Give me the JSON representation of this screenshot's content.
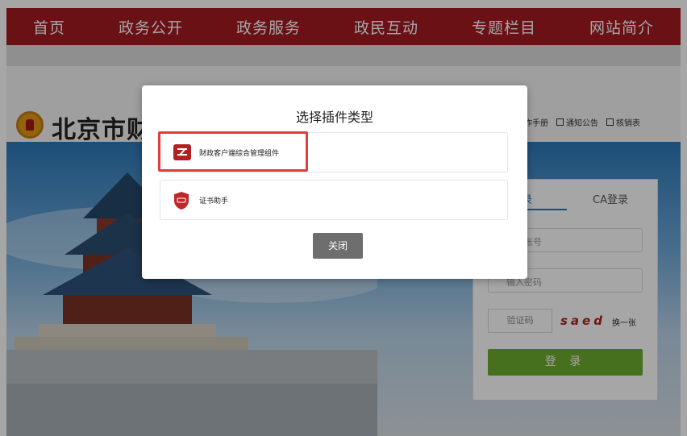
{
  "nav": {
    "items": [
      "首页",
      "政务公开",
      "政务服务",
      "政民互动",
      "专题栏目",
      "网站简介"
    ]
  },
  "header": {
    "site_title": "北京市财政",
    "links": [
      "操作手册",
      "通知公告",
      "核销表"
    ]
  },
  "login": {
    "tab_account_partial": "录",
    "tab_ca": "CA登录",
    "account_placeholder_partial": "账号",
    "password_placeholder_partial": "输入密码",
    "captcha_label": "验证码",
    "captcha_code": "saed",
    "refresh_label": "换一张",
    "submit_label": "登 录"
  },
  "modal": {
    "title": "选择插件类型",
    "options": [
      {
        "label": "财政客户端综合管理组件",
        "icon": "finance-client-icon"
      },
      {
        "label": "证书助手",
        "icon": "certificate-shield-icon"
      }
    ],
    "close_label": "关闭"
  },
  "colors": {
    "nav_bg": "#a41b23",
    "highlight": "#e23d3d",
    "submit_bg": "#6cab2e",
    "accent_blue": "#1a7ad0"
  }
}
